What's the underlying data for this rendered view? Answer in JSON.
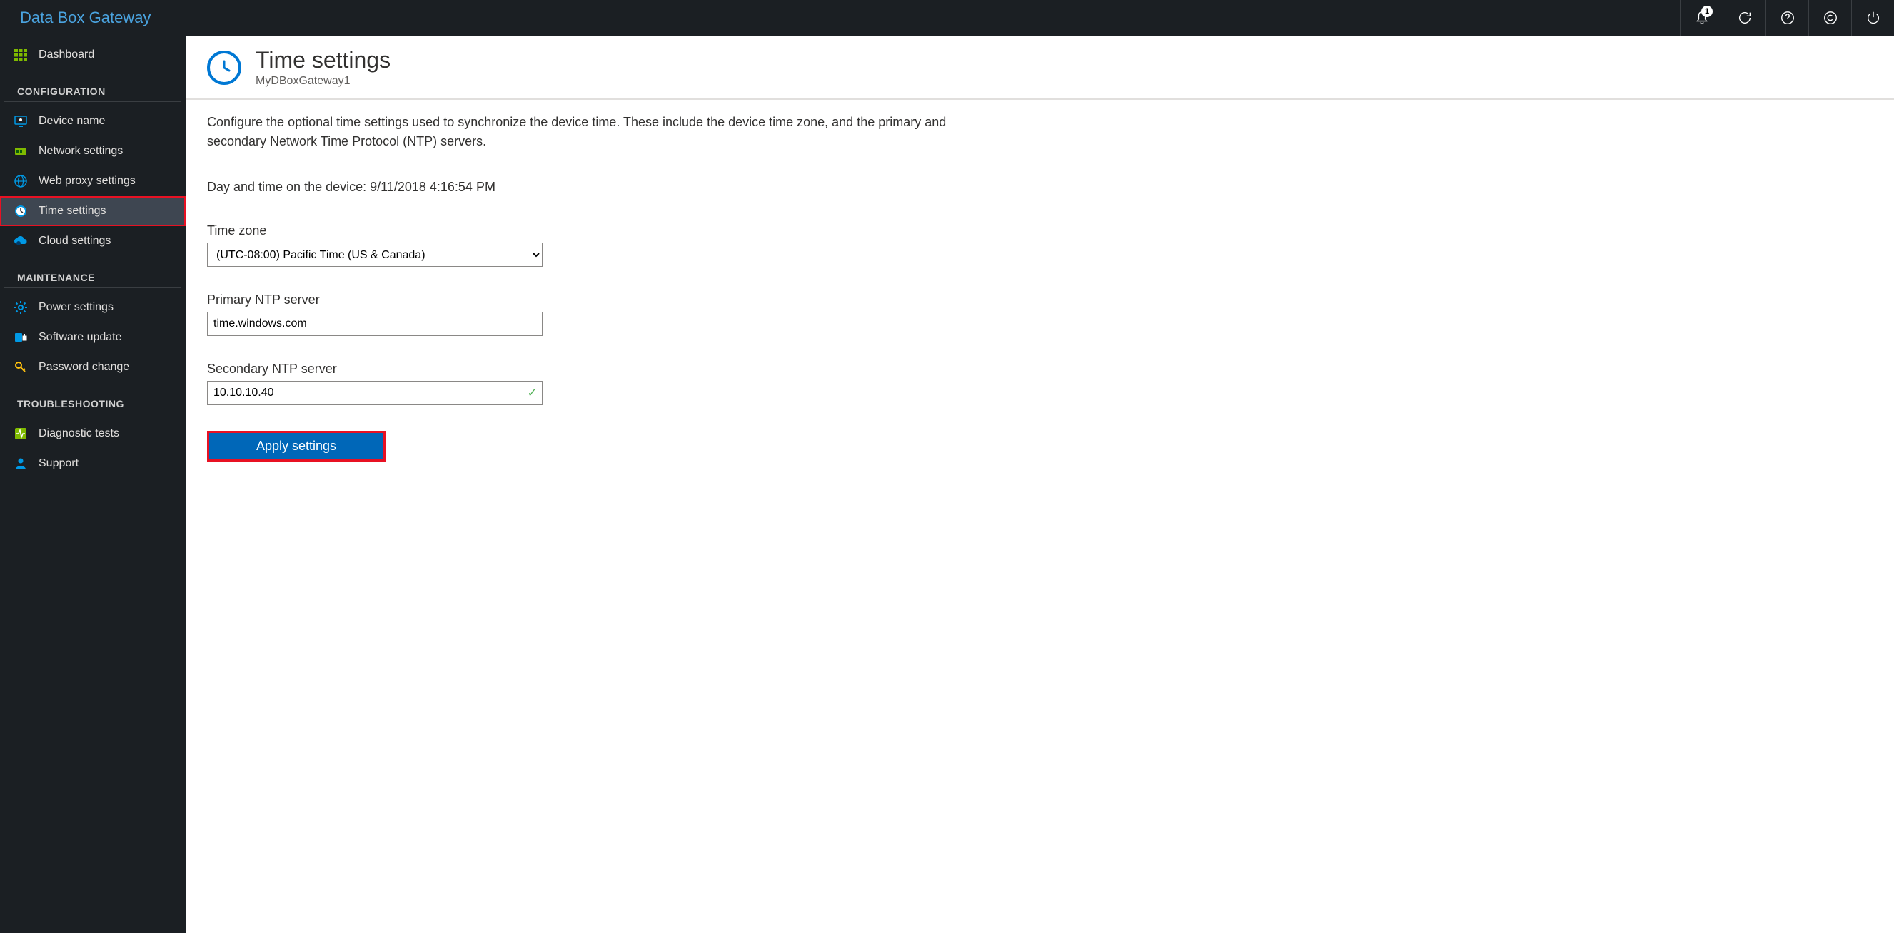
{
  "brand": "Data Box Gateway",
  "notification_count": "1",
  "sidebar": {
    "dashboard": "Dashboard",
    "group_config": "CONFIGURATION",
    "device_name": "Device name",
    "network_settings": "Network settings",
    "web_proxy_settings": "Web proxy settings",
    "time_settings": "Time settings",
    "cloud_settings": "Cloud settings",
    "group_maint": "MAINTENANCE",
    "power_settings": "Power settings",
    "software_update": "Software update",
    "password_change": "Password change",
    "group_trouble": "TROUBLESHOOTING",
    "diagnostic_tests": "Diagnostic tests",
    "support": "Support"
  },
  "page": {
    "title": "Time settings",
    "subtitle": "MyDBoxGateway1",
    "description": "Configure the optional time settings used to synchronize the device time. These include the device time zone, and the primary and secondary Network Time Protocol (NTP) servers.",
    "device_time_label": "Day and time on the device: ",
    "device_time_value": "9/11/2018 4:16:54 PM",
    "tz_label": "Time zone",
    "tz_value": "(UTC-08:00) Pacific Time (US & Canada)",
    "primary_label": "Primary NTP server",
    "primary_value": "time.windows.com",
    "secondary_label": "Secondary NTP server",
    "secondary_value": "10.10.10.40",
    "apply_label": "Apply settings"
  }
}
